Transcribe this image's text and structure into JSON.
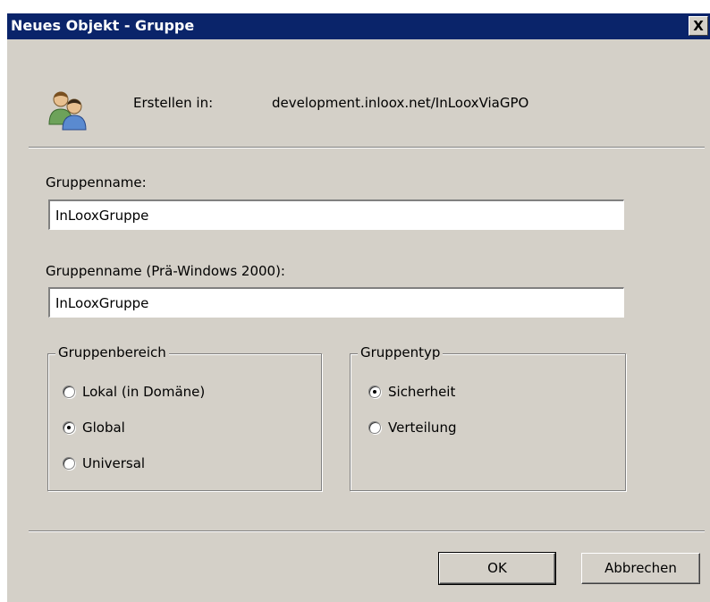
{
  "window": {
    "title": "Neues Objekt - Gruppe",
    "close_label": "X"
  },
  "header": {
    "create_in_label": "Erstellen in:",
    "create_in_path": "development.inloox.net/InLooxViaGPO",
    "icon": "users-icon"
  },
  "fields": {
    "group_name_label": "Gruppenname:",
    "group_name_value": "InLooxGruppe",
    "group_name_pre2000_label": "Gruppenname (Prä-Windows 2000):",
    "group_name_pre2000_value": "InLooxGruppe"
  },
  "group_scope": {
    "legend": "Gruppenbereich",
    "options": [
      {
        "label": "Lokal (in Domäne)",
        "checked": false
      },
      {
        "label": "Global",
        "checked": true
      },
      {
        "label": "Universal",
        "checked": false
      }
    ]
  },
  "group_type": {
    "legend": "Gruppentyp",
    "options": [
      {
        "label": "Sicherheit",
        "checked": true
      },
      {
        "label": "Verteilung",
        "checked": false
      }
    ]
  },
  "buttons": {
    "ok_label": "OK",
    "cancel_label": "Abbrechen"
  },
  "colors": {
    "titlebar": "#0a246a",
    "face": "#d4d0c8"
  }
}
